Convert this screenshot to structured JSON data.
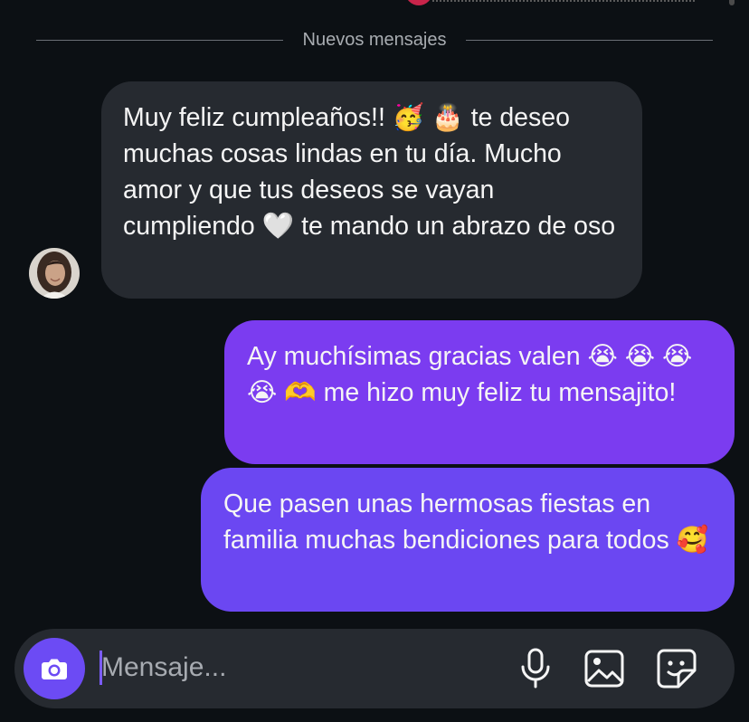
{
  "divider": {
    "label": "Nuevos mensajes"
  },
  "messages": [
    {
      "sender": "other",
      "segments": [
        "Muy feliz cumpleaños!! ",
        "🥳",
        " ",
        "🎂",
        " te deseo muchas cosas lindas en tu día. Mucho amor y que tus deseos se vayan cumpliendo ",
        "🤍",
        " te mando un abrazo de oso"
      ]
    },
    {
      "sender": "me",
      "segments": [
        "Ay muchísimas gracias valen ",
        "😭",
        " ",
        "😭",
        " ",
        "😭",
        " ",
        "😭",
        " ",
        "🫶",
        " me hizo muy feliz tu mensajito!"
      ]
    },
    {
      "sender": "me",
      "segments": [
        "Que pasen unas hermosas fiestas en familia muchas bendiciones para todos ",
        "🥰"
      ]
    }
  ],
  "composer": {
    "placeholder": "Mensaje...",
    "value": ""
  },
  "icons": {
    "camera": "camera-icon",
    "microphone": "microphone-icon",
    "gallery": "gallery-icon",
    "sticker": "sticker-icon"
  },
  "colors": {
    "background": "#0c1014",
    "incoming_bubble": "#262a30",
    "outgoing_bubble_1": "#7b3cf0",
    "outgoing_bubble_2": "#6b47f2",
    "accent": "#6c4bf4"
  }
}
